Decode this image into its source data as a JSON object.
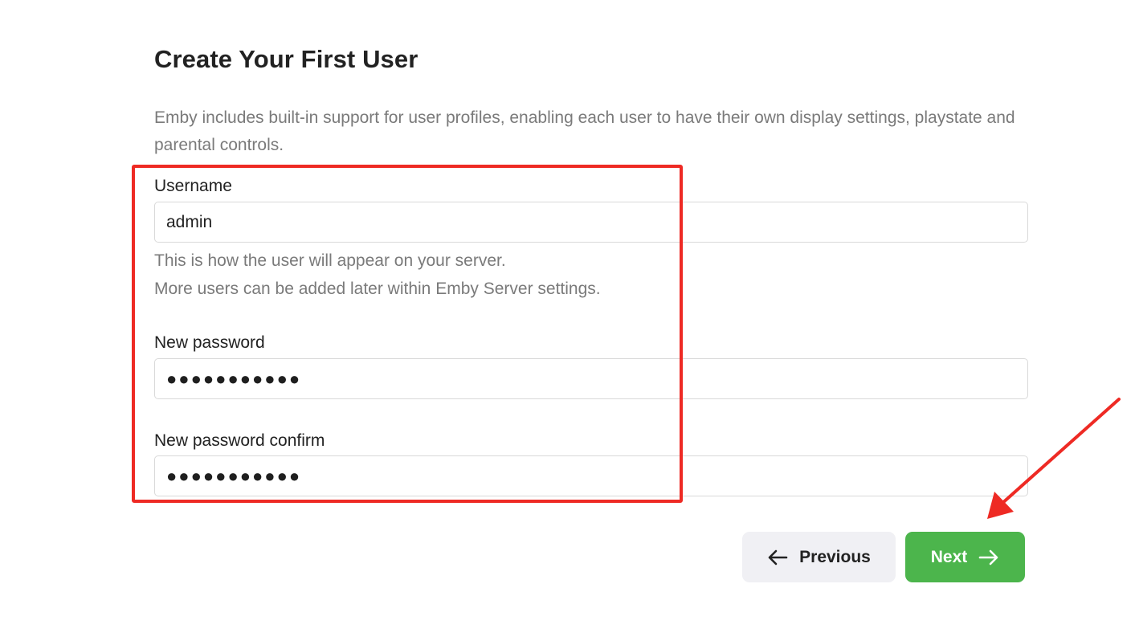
{
  "page": {
    "title": "Create Your First User",
    "description": "Emby includes built-in support for user profiles, enabling each user to have their own display settings, playstate and parental controls."
  },
  "form": {
    "username": {
      "label": "Username",
      "value": "admin",
      "help_line1": "This is how the user will appear on your server.",
      "help_line2": "More users can be added later within Emby Server settings."
    },
    "password": {
      "label": "New password",
      "value": "●●●●●●●●●●●"
    },
    "password_confirm": {
      "label": "New password confirm",
      "value": "●●●●●●●●●●●"
    }
  },
  "actions": {
    "previous_label": "Previous",
    "next_label": "Next"
  },
  "colors": {
    "accent": "#4cb54c",
    "annotation": "#ee2a24",
    "secondary_button": "#f0f0f4"
  },
  "icons": {
    "previous": "arrow-left-icon",
    "next": "arrow-right-icon"
  }
}
